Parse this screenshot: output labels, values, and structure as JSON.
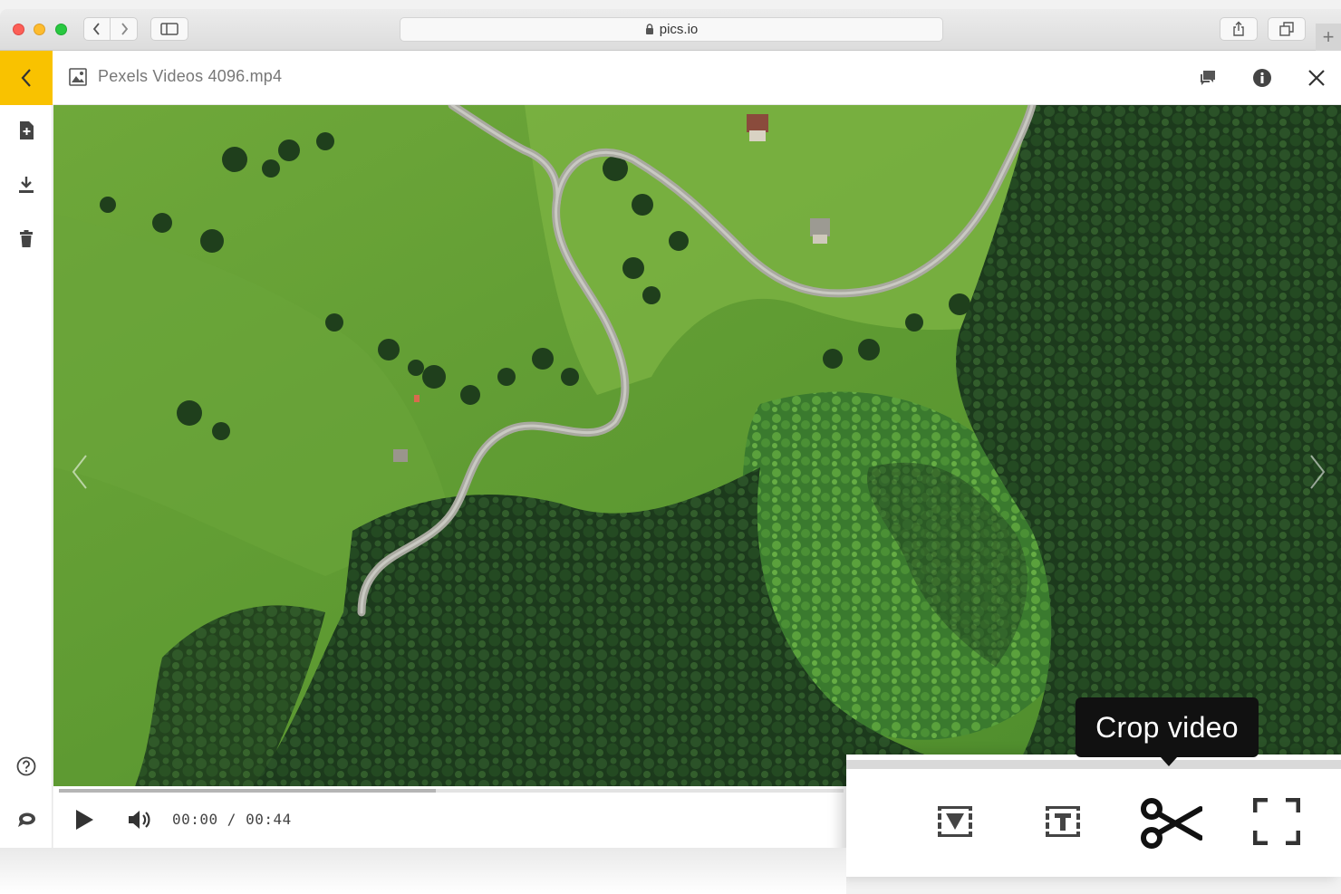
{
  "browser": {
    "address": "pics.io"
  },
  "header": {
    "file_title": "Pexels Videos 4096.mp4"
  },
  "player": {
    "current_time": "00:00",
    "duration": "00:44",
    "time_separator": " / ",
    "buffered_fraction": 0.48
  },
  "tooltip": {
    "text": "Crop video"
  },
  "icons": {
    "back": "chevron-left-icon",
    "file": "image-icon",
    "comments": "comments-icon",
    "info": "info-icon",
    "close": "close-icon",
    "add": "file-add-icon",
    "download": "download-icon",
    "delete": "trash-icon",
    "help": "help-icon",
    "chat": "chat-icon",
    "play": "play-icon",
    "volume": "volume-icon",
    "video_frame": "video-frame-icon",
    "text": "text-icon",
    "crop": "scissors-icon",
    "fullscreen": "fullscreen-icon"
  },
  "colors": {
    "accent": "#f9c200",
    "tooltip_bg": "#111111"
  }
}
